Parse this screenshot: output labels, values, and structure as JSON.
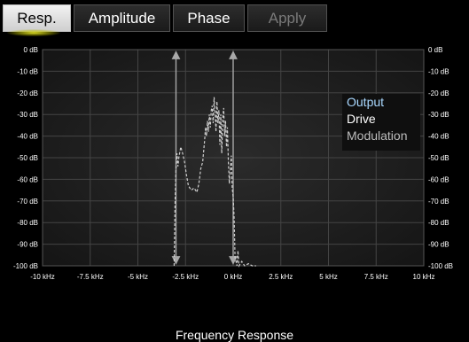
{
  "tabs": [
    {
      "label": "Resp.",
      "state": "active"
    },
    {
      "label": "Amplitude",
      "state": "normal"
    },
    {
      "label": "Phase",
      "state": "normal"
    },
    {
      "label": "Apply",
      "state": "disabled"
    }
  ],
  "legend": [
    {
      "label": "Output",
      "color": "#a9d8ff"
    },
    {
      "label": "Drive",
      "color": "#ffffff"
    },
    {
      "label": "Modulation",
      "color": "#bdbdbd"
    }
  ],
  "chart_data": {
    "type": "line",
    "title": "",
    "xlabel": "Frequency Response",
    "ylabel": "",
    "xlim": [
      -10,
      10
    ],
    "ylim": [
      -100,
      0
    ],
    "x_ticks": [
      -10,
      -7.5,
      -5,
      -2.5,
      0,
      2.5,
      5,
      7.5,
      10
    ],
    "x_tick_labels": [
      "-10 kHz",
      "-7.5 kHz",
      "-5 kHz",
      "-2.5 kHz",
      "0 kHz",
      "2.5 kHz",
      "5 kHz",
      "7.5 kHz",
      "10 kHz"
    ],
    "y_ticks": [
      0,
      -10,
      -20,
      -30,
      -40,
      -50,
      -60,
      -70,
      -80,
      -90,
      -100
    ],
    "y_tick_labels": [
      "0 dB",
      "-10 dB",
      "-20 dB",
      "-30 dB",
      "-40 dB",
      "-50 dB",
      "-60 dB",
      "-70 dB",
      "-80 dB",
      "-90 dB",
      "-100 dB"
    ],
    "grid": true,
    "legend_position": "top-right",
    "series": [
      {
        "name": "Drive",
        "style": "dashed",
        "color": "#cfcfcf",
        "points": [
          [
            -3.1,
            -100
          ],
          [
            -3.05,
            -72
          ],
          [
            -3.0,
            -55
          ],
          [
            -2.95,
            -48
          ],
          [
            -2.9,
            -54
          ],
          [
            -2.85,
            -50
          ],
          [
            -2.75,
            -45
          ],
          [
            -2.65,
            -48
          ],
          [
            -2.55,
            -52
          ],
          [
            -2.45,
            -58
          ],
          [
            -2.35,
            -63
          ],
          [
            -2.2,
            -65
          ],
          [
            -2.05,
            -64
          ],
          [
            -1.9,
            -66
          ],
          [
            -1.8,
            -62
          ],
          [
            -1.7,
            -55
          ],
          [
            -1.6,
            -52
          ],
          [
            -1.5,
            -42
          ],
          [
            -1.45,
            -36
          ],
          [
            -1.4,
            -40
          ],
          [
            -1.35,
            -33
          ],
          [
            -1.3,
            -38
          ],
          [
            -1.25,
            -30
          ],
          [
            -1.2,
            -36
          ],
          [
            -1.15,
            -28
          ],
          [
            -1.1,
            -26
          ],
          [
            -1.05,
            -34
          ],
          [
            -1.0,
            -22
          ],
          [
            -0.95,
            -29
          ],
          [
            -0.9,
            -38
          ],
          [
            -0.85,
            -24
          ],
          [
            -0.8,
            -34
          ],
          [
            -0.75,
            -28
          ],
          [
            -0.7,
            -44
          ],
          [
            -0.65,
            -30
          ],
          [
            -0.6,
            -48
          ],
          [
            -0.55,
            -32
          ],
          [
            -0.5,
            -27
          ],
          [
            -0.45,
            -40
          ],
          [
            -0.4,
            -33
          ],
          [
            -0.35,
            -45
          ],
          [
            -0.3,
            -36
          ],
          [
            -0.25,
            -52
          ],
          [
            -0.2,
            -62
          ],
          [
            -0.15,
            -56
          ],
          [
            -0.1,
            -49
          ],
          [
            -0.05,
            -64
          ],
          [
            0.0,
            -68
          ],
          [
            0.05,
            -78
          ],
          [
            0.1,
            -96
          ],
          [
            0.2,
            -100
          ],
          [
            0.25,
            -93
          ],
          [
            0.3,
            -100
          ],
          [
            0.45,
            -98
          ],
          [
            0.6,
            -100
          ],
          [
            0.8,
            -99
          ],
          [
            1.0,
            -100
          ],
          [
            1.2,
            -100
          ]
        ]
      }
    ],
    "markers": [
      {
        "x": -3.0,
        "style": "double-arrow",
        "color": "#a8a8a8"
      },
      {
        "x": 0.0,
        "style": "double-arrow",
        "color": "#a8a8a8"
      }
    ]
  }
}
